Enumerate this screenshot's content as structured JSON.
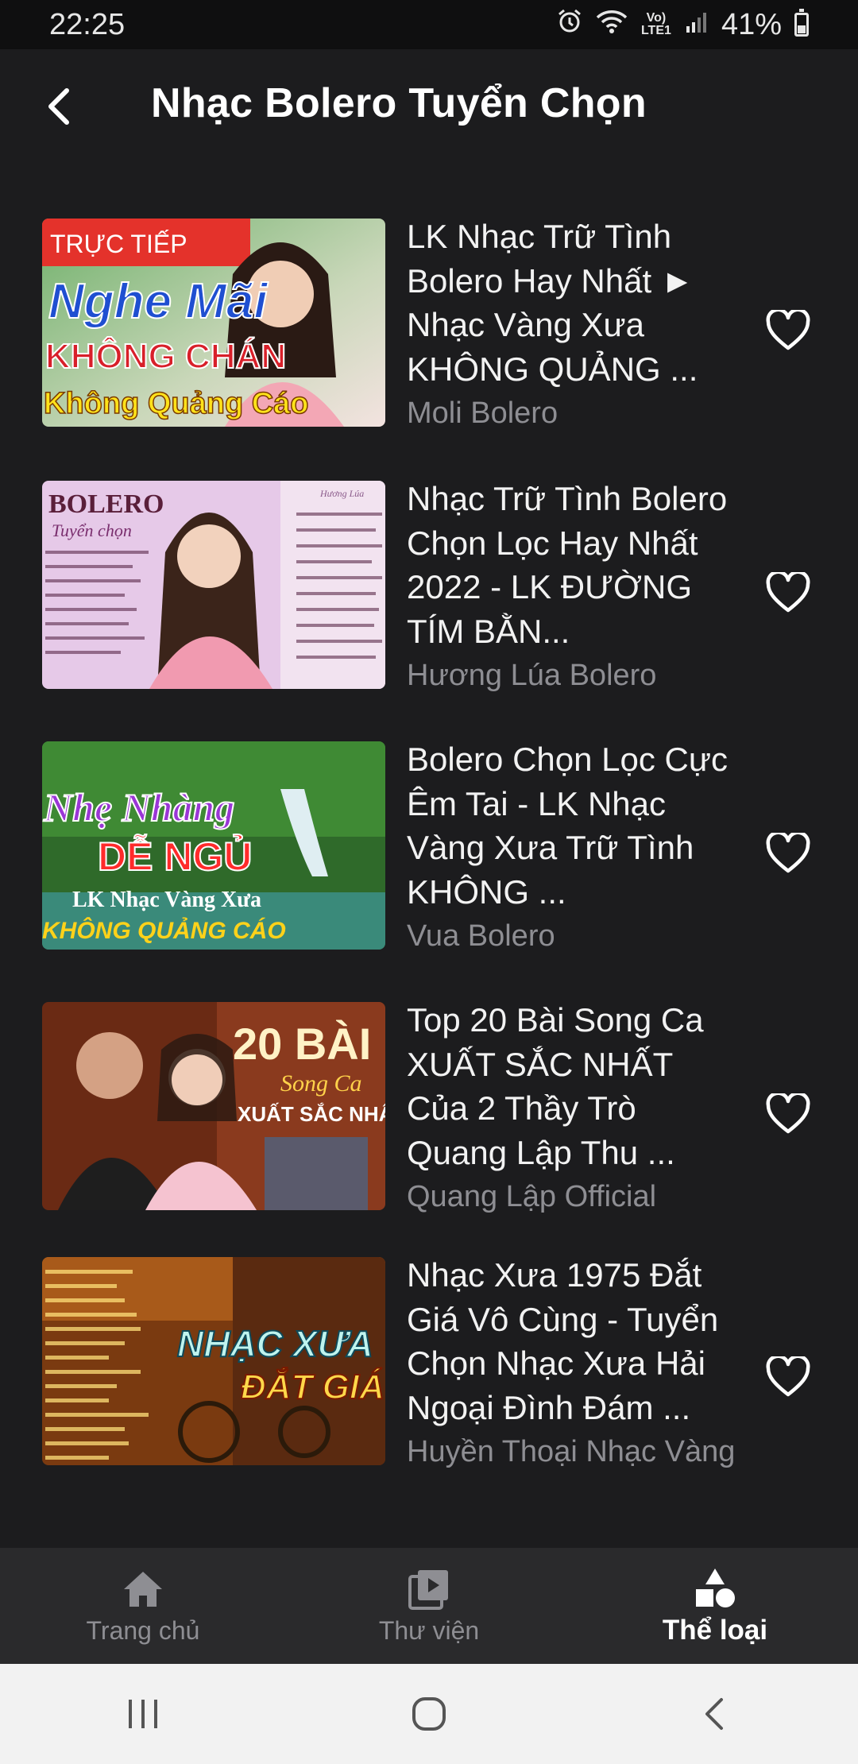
{
  "status_bar": {
    "time": "22:25",
    "network_label": "Vo) LTE1",
    "battery_percent": "41%"
  },
  "header": {
    "title": "Nhạc Bolero Tuyển Chọn"
  },
  "items": [
    {
      "title": "LK Nhạc Trữ Tình Bolero Hay Nhất ► Nhạc Vàng Xưa KHÔNG QUẢNG ...",
      "channel": "Moli Bolero",
      "thumb": {
        "badge": "TRỰC TIẾP",
        "line1": "Nghe Mãi",
        "line2": "KHÔNG CHÁN",
        "line3": "Không Quảng Cáo"
      }
    },
    {
      "title": "Nhạc Trữ Tình Bolero Chọn Lọc Hay Nhất 2022 - LK ĐƯỜNG TÍM BẰN...",
      "channel": "Hương Lúa Bolero",
      "thumb": {
        "line1": "BOLERO",
        "line2": "Tuyển chọn",
        "singer": "Hương Lúa"
      }
    },
    {
      "title": "Bolero Chọn Lọc Cực Êm Tai - LK Nhạc Vàng Xưa Trữ Tình KHÔNG ...",
      "channel": "Vua Bolero",
      "thumb": {
        "line1": "Nhẹ Nhàng",
        "line2": "DỄ NGỦ",
        "line3": "LK Nhạc Vàng Xưa",
        "line4": "KHÔNG QUẢNG CÁO"
      }
    },
    {
      "title": "Top 20 Bài Song Ca XUẤT SẮC NHẤT Của 2 Thầy Trò Quang Lập Thu ...",
      "channel": "Quang Lập Official",
      "thumb": {
        "line1": "20 BÀI",
        "line2": "Song Ca",
        "line3": "XUẤT SẮC NHẤT"
      }
    },
    {
      "title": "Nhạc Xưa 1975 Đắt Giá Vô Cùng - Tuyển Chọn Nhạc Xưa Hải Ngoại Đình Đám ...",
      "channel": "Huyền Thoại Nhạc Vàng",
      "thumb": {
        "line1": "NHẠC XƯA",
        "line2": "ĐẮT GIÁ"
      }
    }
  ],
  "bottom_nav": {
    "tabs": [
      {
        "label": "Trang chủ",
        "icon": "home-icon"
      },
      {
        "label": "Thư viện",
        "icon": "library-icon"
      },
      {
        "label": "Thể loại",
        "icon": "genre-icon",
        "active": true
      }
    ]
  },
  "system_nav": {
    "buttons": [
      "recents-icon",
      "home-circle-icon",
      "back-chevron-icon"
    ]
  },
  "colors": {
    "background": "#1c1c1e",
    "status_bar": "#0f0f10",
    "secondary_text": "#8e8e93",
    "bottom_nav": "#2a2a2c",
    "system_nav": "#f2f2f2"
  }
}
